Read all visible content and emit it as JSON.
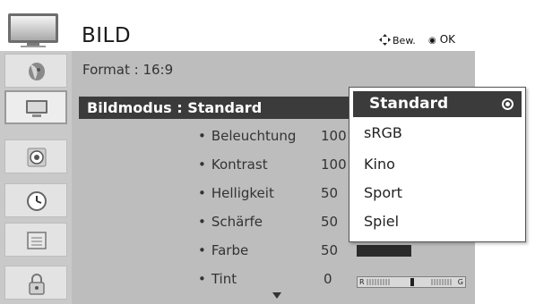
{
  "header": {
    "title": "BILD",
    "hint_move": "Bew.",
    "hint_ok": "OK"
  },
  "sidebar": {
    "items": [
      {
        "name": "setup",
        "icon": "satellite-dish-icon",
        "active": false
      },
      {
        "name": "picture",
        "icon": "tv-screen-icon",
        "active": true
      },
      {
        "name": "audio",
        "icon": "speaker-icon",
        "active": false
      },
      {
        "name": "time",
        "icon": "clock-icon",
        "active": false
      },
      {
        "name": "option",
        "icon": "option-box-icon",
        "active": false
      },
      {
        "name": "lock",
        "icon": "lock-icon",
        "active": false
      }
    ]
  },
  "main": {
    "format_label": "Format",
    "format_value": ": 16:9",
    "mode_label": "Bildmodus : Standard",
    "settings": [
      {
        "label": "Beleuchtung",
        "value": "100",
        "level": 1.0
      },
      {
        "label": "Kontrast",
        "value": "100",
        "level": 1.0
      },
      {
        "label": "Helligkeit",
        "value": "50",
        "level": 0.5
      },
      {
        "label": "Schärfe",
        "value": "50",
        "level": 0.5
      },
      {
        "label": "Farbe",
        "value": "50",
        "level": 0.5
      },
      {
        "label": "Tint",
        "value": "0"
      }
    ],
    "tint_bar": {
      "left": "R",
      "right": "G",
      "value": 0
    }
  },
  "dropdown": {
    "options": [
      "Standard",
      "sRGB",
      "Kino",
      "Sport",
      "Spiel"
    ],
    "selected": "Standard"
  },
  "colors": {
    "sidebar_bg": "#c9c9c9",
    "panel_bg": "#bdbdbd",
    "highlight": "#3b3b3b",
    "dropdown_bg": "#ffffff"
  }
}
